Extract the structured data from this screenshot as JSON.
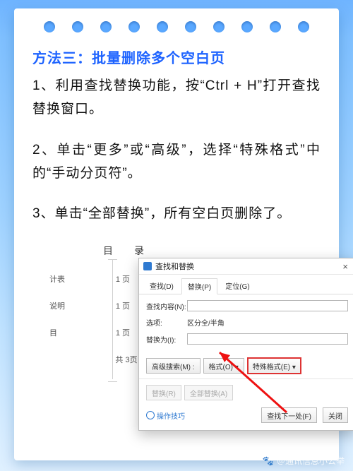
{
  "title": "方法三：批量删除多个空白页",
  "p1": "1、利用查找替换功能，按“Ctrl + H”打开查找替换窗口。",
  "p2": "2、单击“更多”或“高级”，选择“特殊格式”中的“手动分页符”。",
  "p3": "3、单击“全部替换”，所有空白页删除了。",
  "doc": {
    "heading": "目　录",
    "rows": [
      {
        "l": "计表",
        "r": "1 页"
      },
      {
        "l": "说明",
        "r": "1 页"
      },
      {
        "l": "目",
        "r": "1 页"
      }
    ],
    "total": "共  3页"
  },
  "dlg": {
    "title": "查找和替换",
    "close": "×",
    "tabs": {
      "find": "查找(D)",
      "replace": "替换(P)",
      "goto": "定位(G)"
    },
    "label_find": "查找内容(N):",
    "label_opts": "选项:",
    "opts_val": "区分全/半角",
    "label_replace": "替换为(I):",
    "btn_moresearch": "高级搜索(M) :",
    "btn_format": "格式(O) ▾",
    "btn_special": "特殊格式(E) ▾",
    "btn_replace1": "替换(R)",
    "btn_replaceall": "全部替换(A)",
    "tips": "操作技巧",
    "btn_findnext": "查找下一处(F)",
    "btn_close": "关闭"
  },
  "watermark": "＠通讯信息小公举"
}
